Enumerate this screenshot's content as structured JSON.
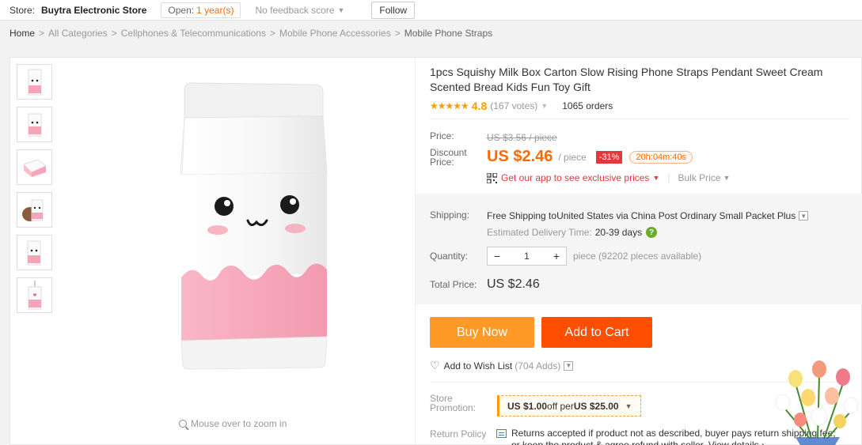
{
  "store": {
    "label": "Store:",
    "name": "Buytra Electronic Store",
    "open_label": "Open:",
    "open_value": "1 year(s)",
    "feedback": "No feedback score",
    "follow": "Follow"
  },
  "breadcrumb": [
    "Home",
    "All Categories",
    "Cellphones & Telecommunications",
    "Mobile Phone Accessories",
    "Mobile Phone Straps"
  ],
  "gallery": {
    "zoom_hint": "Mouse over to zoom in"
  },
  "product": {
    "title": "1pcs Squishy Milk Box Carton Slow Rising Phone Straps Pendant Sweet Cream Scented Bread Kids Fun Toy Gift",
    "stars": "★★★★★",
    "rating": "4.8",
    "votes": "(167 votes)",
    "orders": "1065 orders"
  },
  "price": {
    "price_label": "Price:",
    "old": "US $3.56 / piece",
    "discount_label_1": "Discount",
    "discount_label_2": "Price:",
    "current": "US $2.46",
    "per": "/ piece",
    "percent": "-31%",
    "timer": "20h:04m:40s",
    "app_text": "Get our app to see exclusive prices",
    "bulk": "Bulk Price"
  },
  "shipping": {
    "label": "Shipping:",
    "free": "Free Shipping to",
    "dest": " United States via China Post Ordinary Small Packet Plus",
    "est_label": "Estimated Delivery Time:",
    "est_days": "20-39 days",
    "help": "?"
  },
  "quantity": {
    "label": "Quantity:",
    "minus": "−",
    "value": "1",
    "plus": "+",
    "available": "piece (92202 pieces available)"
  },
  "total": {
    "label": "Total Price:",
    "value": "US $2.46"
  },
  "actions": {
    "buy_now": "Buy Now",
    "add_to_cart": "Add to Cart",
    "wishlist": "Add to Wish List",
    "wishlist_count": "(704 Adds)"
  },
  "promotion": {
    "label_1": "Store",
    "label_2": "Promotion:",
    "amount": "US $1.00",
    "off_per": " off per ",
    "threshold": "US $25.00"
  },
  "return_policy": {
    "label": "Return Policy",
    "text": "Returns accepted if product not as described, buyer pays return shipping fee; or keep the product & agree refund with seller. View details ›"
  },
  "colors": {
    "accent_orange": "#ff6a00",
    "buy_now": "#ff9a26",
    "add_to_cart": "#ff4e00",
    "discount_badge": "#e4393c",
    "star": "#ff9a00"
  },
  "icons": [
    "chevron-down-icon",
    "qr-code-icon",
    "help-icon",
    "heart-icon",
    "search-icon",
    "return-policy-icon"
  ]
}
